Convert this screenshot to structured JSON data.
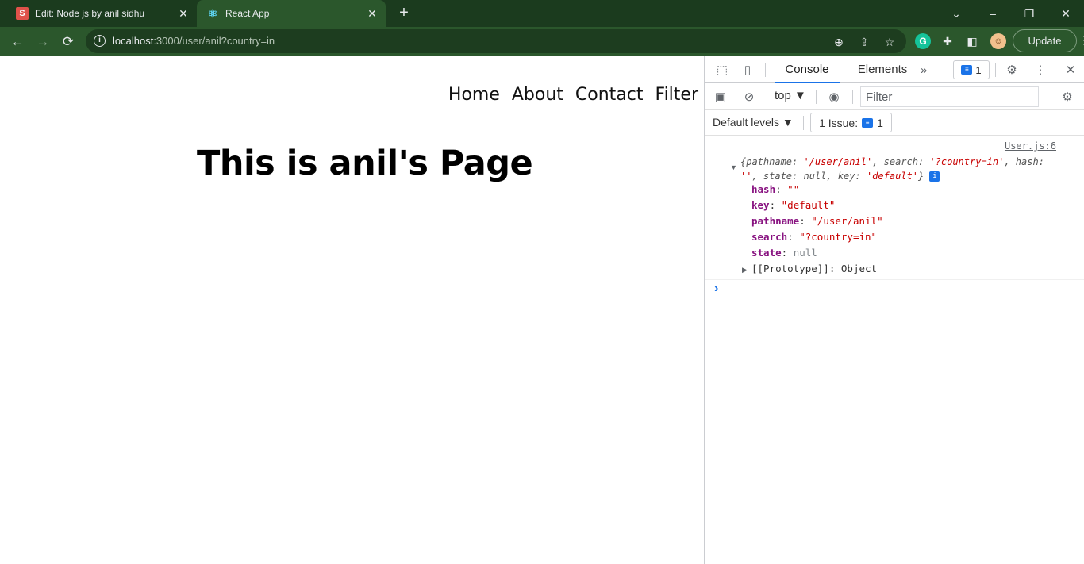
{
  "browser": {
    "tabs": [
      {
        "title": "Edit: Node js by anil sidhu",
        "favicon": "S"
      },
      {
        "title": "React App",
        "favicon": "react-logo"
      }
    ],
    "url_host": "localhost",
    "url_rest": ":3000/user/anil?country=in",
    "update_label": "Update"
  },
  "page": {
    "nav": [
      "Home",
      "About",
      "Contact",
      "Filter"
    ],
    "heading": "This is anil's Page"
  },
  "devtools": {
    "tabs": {
      "console": "Console",
      "elements": "Elements"
    },
    "message_count": "1",
    "context": "top ▼",
    "filter_placeholder": "Filter",
    "levels": "Default levels ▼",
    "issues_label": "1 Issue:",
    "issues_count": "1",
    "log": {
      "source": "User.js:6",
      "summary": {
        "p1": "{pathname: ",
        "v1": "'/user/anil'",
        "p2": ", search: ",
        "v2": "'?country=in'",
        "p3": ", hash: ",
        "v3": "''",
        "p4": ", state: null, key: ",
        "v4": "'default'",
        "p5": "}"
      },
      "props": [
        {
          "key": "hash",
          "value": "\"\"",
          "type": "string"
        },
        {
          "key": "key",
          "value": "\"default\"",
          "type": "string"
        },
        {
          "key": "pathname",
          "value": "\"/user/anil\"",
          "type": "string"
        },
        {
          "key": "search",
          "value": "\"?country=in\"",
          "type": "string"
        },
        {
          "key": "state",
          "value": "null",
          "type": "null"
        }
      ],
      "prototype": "[[Prototype]]",
      "prototype_value": "Object"
    }
  }
}
